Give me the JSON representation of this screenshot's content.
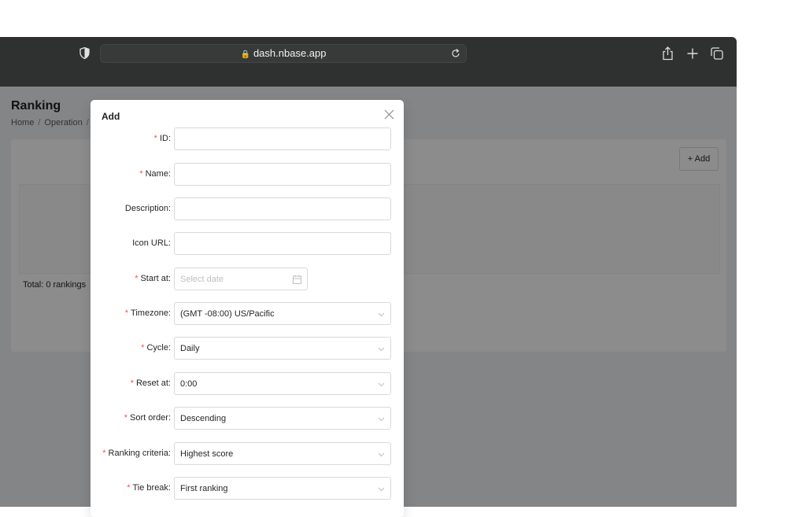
{
  "browser": {
    "url": "dash.nbase.app"
  },
  "page": {
    "title": "Ranking",
    "breadcrumb": [
      "Home",
      "Operation"
    ],
    "add_button": "Add",
    "add_icon": "+",
    "total": "Total: 0 rankings"
  },
  "modal": {
    "title": "Add",
    "fields": {
      "id": {
        "label": "ID:",
        "required": true,
        "value": ""
      },
      "name": {
        "label": "Name:",
        "required": true,
        "value": ""
      },
      "description": {
        "label": "Description:",
        "required": false,
        "value": ""
      },
      "icon_url": {
        "label": "Icon URL:",
        "required": false,
        "value": ""
      },
      "start_at": {
        "label": "Start at:",
        "required": true,
        "placeholder": "Select date"
      },
      "timezone": {
        "label": "Timezone:",
        "required": true,
        "value": "(GMT -08:00) US/Pacific"
      },
      "cycle": {
        "label": "Cycle:",
        "required": true,
        "value": "Daily"
      },
      "reset_at": {
        "label": "Reset at:",
        "required": true,
        "value": "0:00"
      },
      "sort_order": {
        "label": "Sort order:",
        "required": true,
        "value": "Descending"
      },
      "ranking_criteria": {
        "label": "Ranking criteria:",
        "required": true,
        "value": "Highest score"
      },
      "tie_break": {
        "label": "Tie break:",
        "required": true,
        "value": "First ranking"
      }
    }
  },
  "colors": {
    "toolbar": "#2f3030",
    "required": "#ff4d4f",
    "overlay": "rgba(0,0,0,0.45)"
  }
}
